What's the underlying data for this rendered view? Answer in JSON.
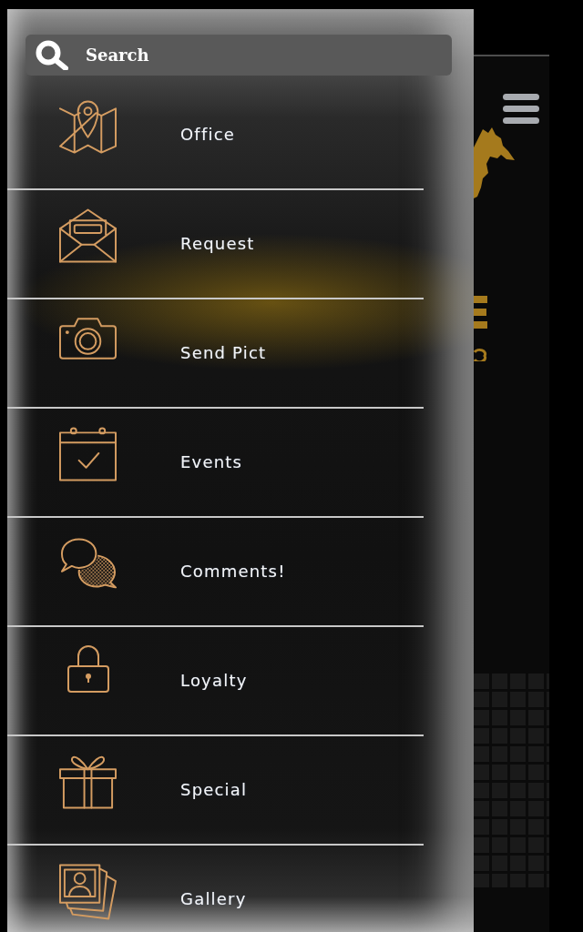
{
  "search": {
    "placeholder": "Search"
  },
  "menu": {
    "items": [
      {
        "label": "Office"
      },
      {
        "label": "Request"
      },
      {
        "label": "Send Pict"
      },
      {
        "label": "Events"
      },
      {
        "label": "Comments!"
      },
      {
        "label": "Loyalty"
      },
      {
        "label": "Special"
      },
      {
        "label": "Gallery"
      }
    ]
  }
}
